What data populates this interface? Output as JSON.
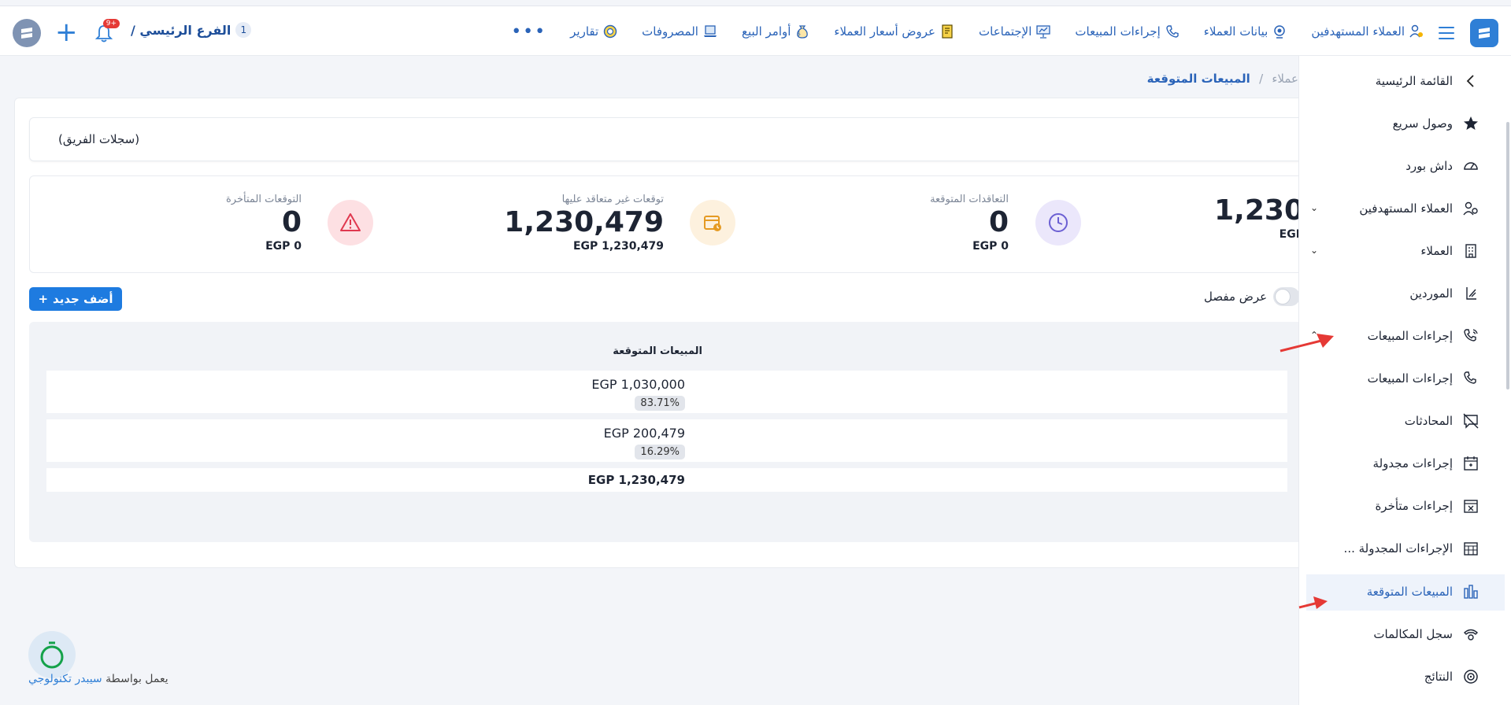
{
  "nav": {
    "items": [
      {
        "label": "العملاء المستهدفين",
        "icon": "target-customers-icon"
      },
      {
        "label": "بيانات العملاء",
        "icon": "customer-data-icon"
      },
      {
        "label": "إجراءات المبيعات",
        "icon": "phone-icon"
      },
      {
        "label": "الإجتماعات",
        "icon": "presentation-icon"
      },
      {
        "label": "عروض أسعار العملاء",
        "icon": "quote-icon"
      },
      {
        "label": "أوامر البيع",
        "icon": "money-bag-icon"
      },
      {
        "label": "المصروفات",
        "icon": "laptop-icon"
      },
      {
        "label": "تقارير",
        "icon": "report-icon"
      }
    ],
    "more": "•••"
  },
  "branch": {
    "name": "الفرع الرئيسي /",
    "number": "1"
  },
  "notifications": {
    "badge": "+9"
  },
  "breadcrumb": {
    "previous": "عملاء",
    "separator": "/",
    "current": "المبيعات المتوقعة"
  },
  "team_records": "(سجلات الفريق)",
  "stats": [
    {
      "label": "",
      "value": "1,230",
      "sub": "EGP"
    },
    {
      "label": "التعاقدات المتوقعة",
      "value": "0",
      "sub": "EGP 0"
    },
    {
      "label": "توقعات غير متعاقد عليها",
      "value": "1,230,479",
      "sub": "EGP 1,230,479"
    },
    {
      "label": "التوقعات المتأخرة",
      "value": "0",
      "sub": "EGP 0"
    }
  ],
  "toggle_label": "عرض مفصل",
  "add_button": "أضف جديد",
  "table": {
    "header": "المبيعات المتوقعة",
    "rows": [
      {
        "amount": "EGP 1,030,000",
        "percent": "83.71%"
      },
      {
        "amount": "EGP 200,479",
        "percent": "16.29%"
      }
    ],
    "total": "EGP 1,230,479"
  },
  "sidebar": {
    "items": [
      {
        "label": "القائمة الرئيسية",
        "icon": "chevron-left-icon"
      },
      {
        "label": "وصول سريع",
        "icon": "star-icon"
      },
      {
        "label": "داش بورد",
        "icon": "gauge-icon"
      },
      {
        "label": "العملاء المستهدفين",
        "icon": "users-icon",
        "expand": "⌄"
      },
      {
        "label": "العملاء",
        "icon": "building-icon",
        "expand": "⌄"
      },
      {
        "label": "الموردين",
        "icon": "supplier-icon"
      },
      {
        "label": "إجراءات المبيعات",
        "icon": "phone-icon",
        "expand": "⌃"
      },
      {
        "label": "إجراءات المبيعات",
        "icon": "phone-icon"
      },
      {
        "label": "المحادثات",
        "icon": "chat-off-icon"
      },
      {
        "label": "إجراءات مجدولة",
        "icon": "calendar-icon"
      },
      {
        "label": "إجراءات متأخرة",
        "icon": "calendar-x-icon"
      },
      {
        "label": "الإجراءات المجدولة ...",
        "icon": "calendar-grid-icon"
      },
      {
        "label": "المبيعات المتوقعة",
        "icon": "bar-chart-icon"
      },
      {
        "label": "سجل المكالمات",
        "icon": "telephone-icon"
      },
      {
        "label": "النتائج",
        "icon": "target-icon"
      }
    ]
  },
  "footer": {
    "prefix": "يعمل بواسطة",
    "brand": "سيبدر تكنولوجي"
  },
  "colors": {
    "accent": "#2f7fd6",
    "arrow": "#e53935"
  }
}
